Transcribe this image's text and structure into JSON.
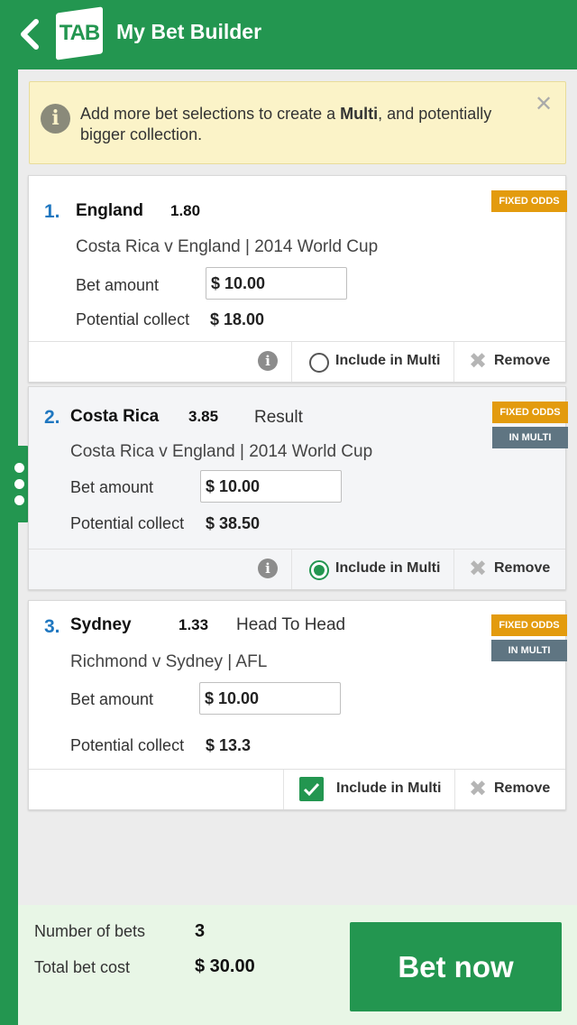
{
  "header": {
    "title": "My Bet Builder",
    "logo_text": "TAB"
  },
  "notice": {
    "text_before": "Add more bet selections to create a ",
    "text_bold": "Multi",
    "text_after": ", and potentially bigger collection."
  },
  "labels": {
    "bet_amount": "Bet amount",
    "potential_collect": "Potential collect",
    "include_in_multi": "Include in Multi",
    "remove": "Remove",
    "fixed_odds": "FIXED ODDS",
    "in_multi": "IN MULTI"
  },
  "bets": [
    {
      "number": "1.",
      "selection": "England",
      "odds": "1.80",
      "type": "",
      "event": "Costa Rica v England  |  2014 World Cup",
      "amount": "$ 10.00",
      "potential": "$ 18.00",
      "in_multi": false
    },
    {
      "number": "2.",
      "selection": "Costa Rica",
      "odds": "3.85",
      "type": "Result",
      "event": "Costa Rica v England  |  2014 World Cup",
      "amount": "$ 10.00",
      "potential": "$ 38.50",
      "in_multi": true
    },
    {
      "number": "3.",
      "selection": "Sydney",
      "odds": "1.33",
      "type": "Head To Head",
      "event": "Richmond v Sydney  |   AFL",
      "amount": "$ 10.00",
      "potential": "$ 13.3",
      "in_multi": true
    }
  ],
  "summary": {
    "number_of_bets_label": "Number of bets",
    "number_of_bets": "3",
    "total_cost_label": "Total bet cost",
    "total_cost": "$ 30.00",
    "bet_now": "Bet now"
  },
  "colors": {
    "brand": "#239650",
    "odds_badge": "#e39b0e",
    "multi_badge": "#5f7582",
    "number": "#1f77c0"
  }
}
